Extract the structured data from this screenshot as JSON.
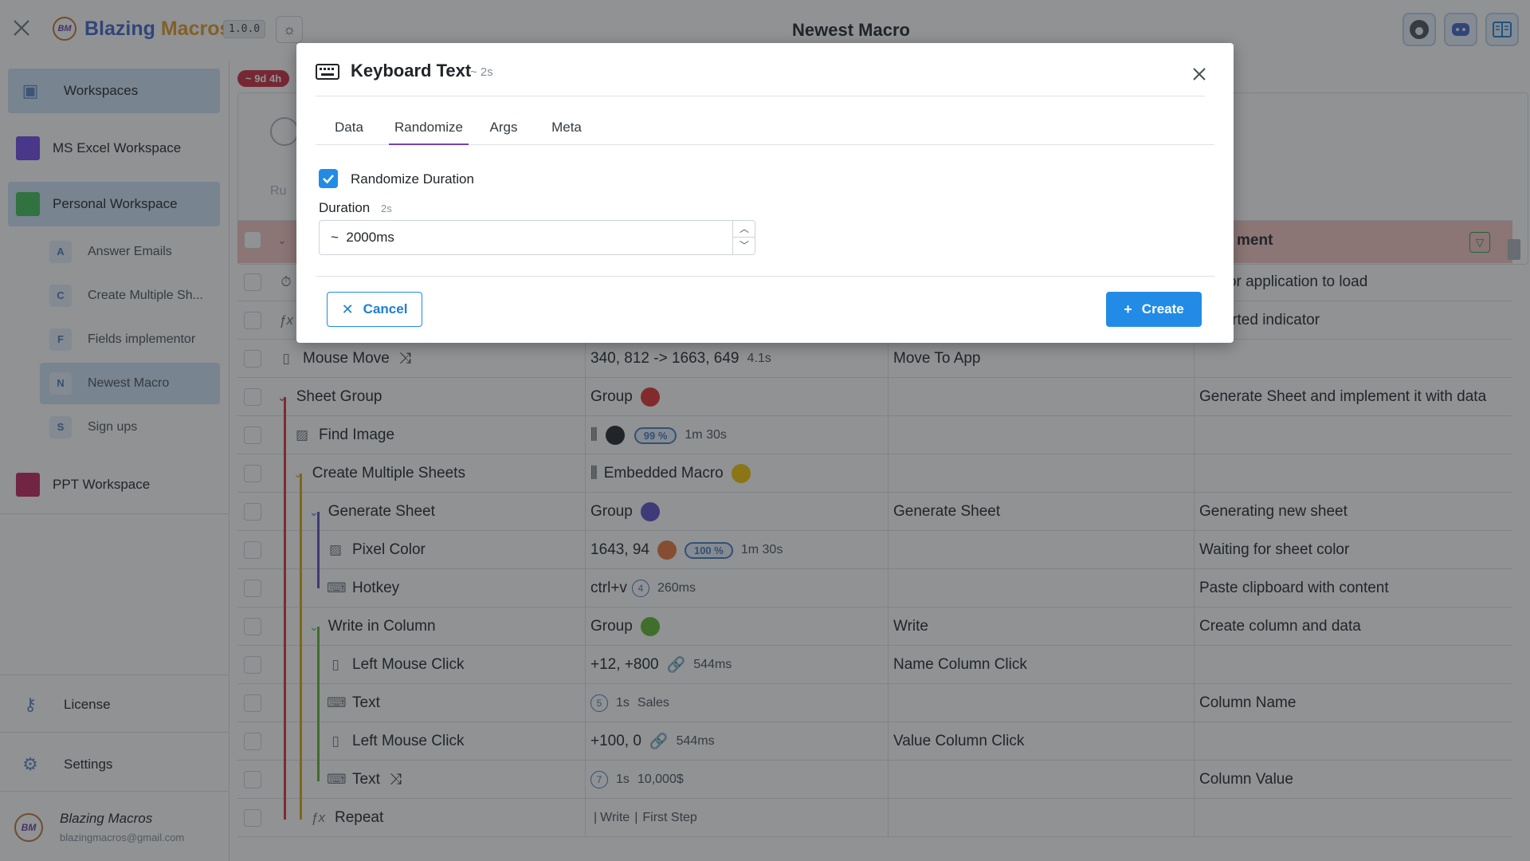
{
  "header": {
    "app_name_prefix": "Blazing",
    "app_name_suffix": "Macros",
    "logo_text": "BM",
    "version": "1.0.0",
    "page_title": "Newest Macro",
    "icons": [
      "close-icon",
      "sun-icon",
      "github-icon",
      "discord-icon",
      "docs-icon"
    ]
  },
  "sidebar": {
    "workspaces_label": "Workspaces",
    "workspaces": [
      {
        "label": "MS Excel Workspace",
        "color": "#7048e8"
      },
      {
        "label": "Personal Workspace",
        "color": "#40c057"
      },
      {
        "label": "PPT Workspace",
        "color": "#c2255c"
      }
    ],
    "macros": [
      {
        "letter": "A",
        "label": "Answer Emails"
      },
      {
        "letter": "C",
        "label": "Create Multiple Sh..."
      },
      {
        "letter": "F",
        "label": "Fields implementor"
      },
      {
        "letter": "N",
        "label": "Newest Macro"
      },
      {
        "letter": "S",
        "label": "Sign ups"
      }
    ],
    "license_label": "License",
    "settings_label": "Settings",
    "user_name": "Blazing Macros",
    "user_email": "blazingmacros@gmail.com"
  },
  "main": {
    "timer_badge": "~ 9d 4h",
    "run_label": "Ru",
    "comment_header": "ment",
    "rows": [
      {
        "name": "",
        "value": "",
        "label": "",
        "comment": "ing for application to load"
      },
      {
        "name": "",
        "value": "",
        "label": "",
        "comment": "o started indicator"
      },
      {
        "name": "Mouse Move",
        "value": "340, 812 -> 1663, 649",
        "extra": "4.1s",
        "label": "Move To App",
        "comment": ""
      },
      {
        "name": "Sheet Group",
        "value": "Group",
        "label": "",
        "comment": "Generate Sheet and implement it with data"
      },
      {
        "name": "Find Image",
        "value": "",
        "pct": "99 %",
        "extra": "1m 30s",
        "label": "",
        "comment": ""
      },
      {
        "name": "Create Multiple Sheets",
        "value": "Embedded Macro",
        "label": "",
        "comment": ""
      },
      {
        "name": "Generate Sheet",
        "value": "Group",
        "label": "Generate Sheet",
        "comment": "Generating new sheet"
      },
      {
        "name": "Pixel Color",
        "value": "1643, 94",
        "pct": "100 %",
        "extra": "1m 30s",
        "label": "",
        "comment": "Waiting for sheet color"
      },
      {
        "name": "Hotkey",
        "value": "ctrl+v",
        "count": "4",
        "extra": "260ms",
        "label": "",
        "comment": "Paste clipboard with content"
      },
      {
        "name": "Write in Column",
        "value": "Group",
        "label": "Write",
        "comment": "Create column and data"
      },
      {
        "name": "Left Mouse Click",
        "value": "+12, +800",
        "extra": "544ms",
        "label": "Name Column Click",
        "comment": ""
      },
      {
        "name": "Text",
        "value": "Sales",
        "count": "5",
        "extra": "1s",
        "label": "",
        "comment": "Column Name"
      },
      {
        "name": "Left Mouse Click",
        "value": "+100, 0",
        "extra": "544ms",
        "label": "Value Column Click",
        "comment": ""
      },
      {
        "name": "Text",
        "value": "10,000$",
        "count": "7",
        "extra": "1s",
        "label": "",
        "comment": "Column Value"
      },
      {
        "name": "Repeat",
        "value": "Write",
        "value2": "First Step",
        "label": "",
        "comment": ""
      }
    ]
  },
  "modal": {
    "title": "Keyboard Text",
    "duration_hint": "~ 2s",
    "tabs": [
      "Data",
      "Randomize",
      "Args",
      "Meta"
    ],
    "active_tab": "Randomize",
    "randomize_checkbox_label": "Randomize Duration",
    "randomize_checked": true,
    "duration_label": "Duration",
    "duration_sub": "2s",
    "duration_value": "~  2000ms",
    "cancel_label": "Cancel",
    "create_label": "Create",
    "accent_color": "#228be6"
  }
}
